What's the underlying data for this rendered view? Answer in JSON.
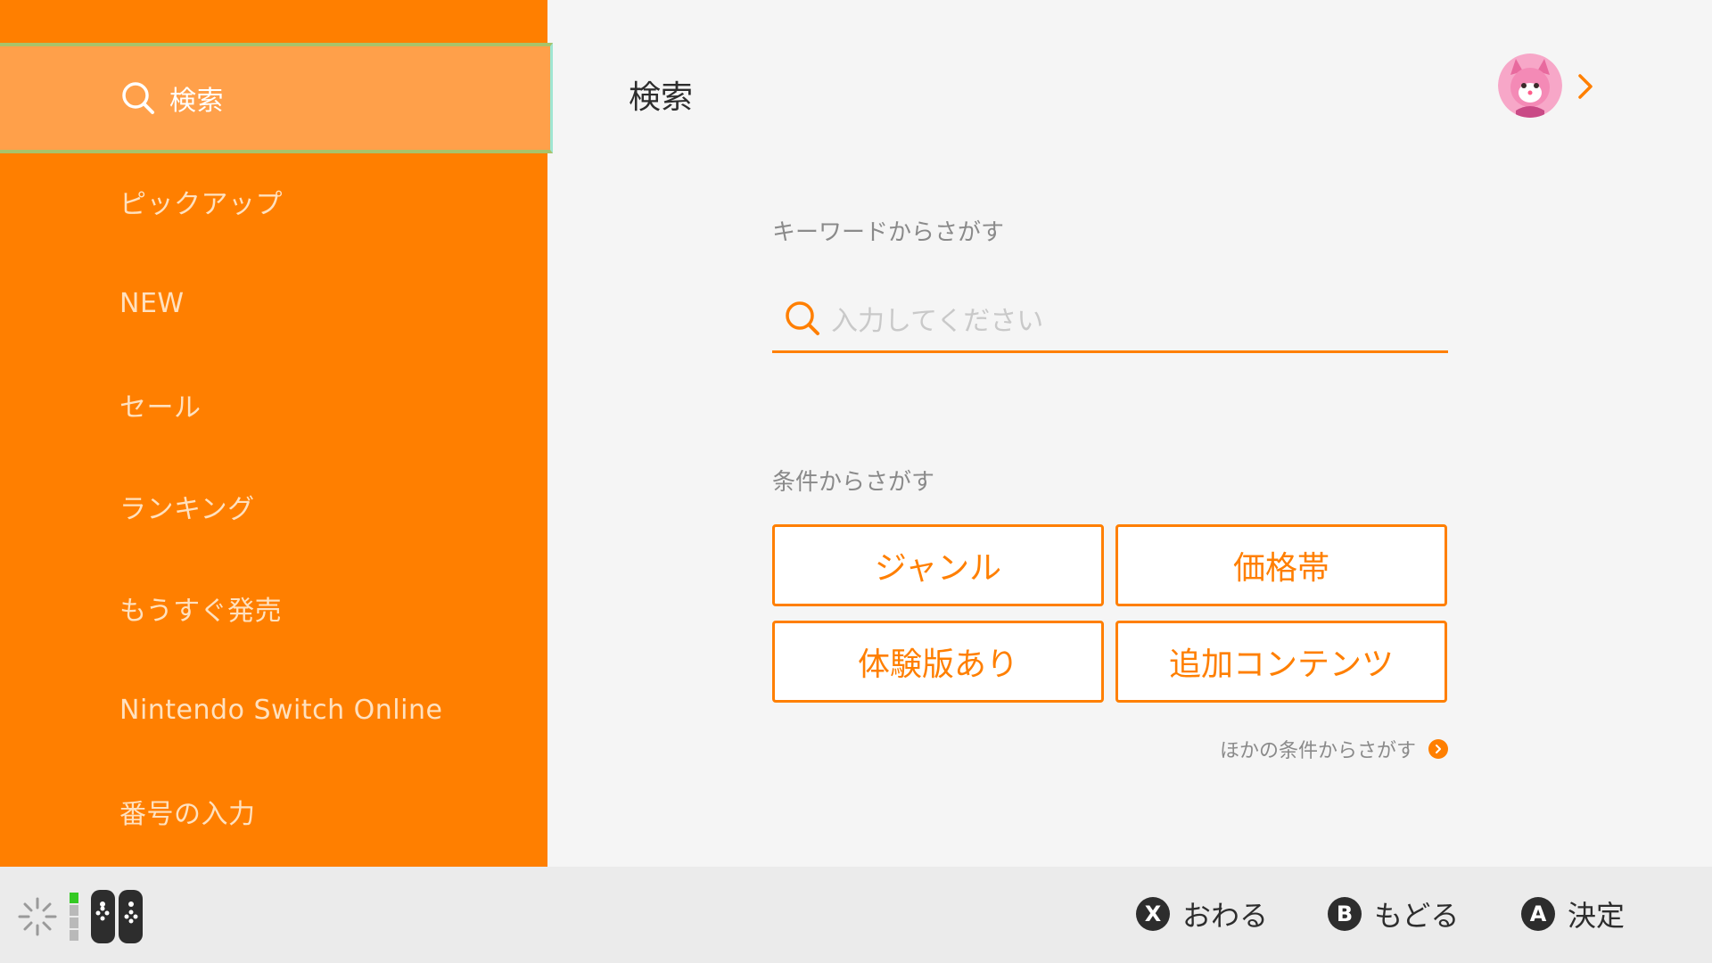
{
  "colors": {
    "accent": "#ff7f00",
    "selected_bg": "#ffa04a",
    "background": "#f5f5f5",
    "footer_bg": "#ebebeb"
  },
  "sidebar": {
    "items": [
      {
        "label": "検索",
        "icon": "search-icon",
        "selected": true
      },
      {
        "label": "ピックアップ"
      },
      {
        "label": "NEW"
      },
      {
        "label": "セール"
      },
      {
        "label": "ランキング"
      },
      {
        "label": "もうすぐ発売"
      },
      {
        "label": "Nintendo Switch Online"
      },
      {
        "label": "番号の入力"
      }
    ]
  },
  "main": {
    "title": "検索",
    "user_icon": "avatar",
    "keyword": {
      "label": "キーワードからさがす",
      "placeholder": "入力してください",
      "icon": "search-icon"
    },
    "conditions": {
      "label": "条件からさがす",
      "buttons": [
        "ジャンル",
        "価格帯",
        "体験版あり",
        "追加コンテンツ"
      ],
      "more_link": "ほかの条件からさがす"
    }
  },
  "footer": {
    "status_icons": [
      "loading-icon",
      "battery-icon",
      "joycon-icon"
    ],
    "buttons": [
      {
        "glyph": "X",
        "label": "おわる"
      },
      {
        "glyph": "B",
        "label": "もどる"
      },
      {
        "glyph": "A",
        "label": "決定"
      }
    ]
  }
}
